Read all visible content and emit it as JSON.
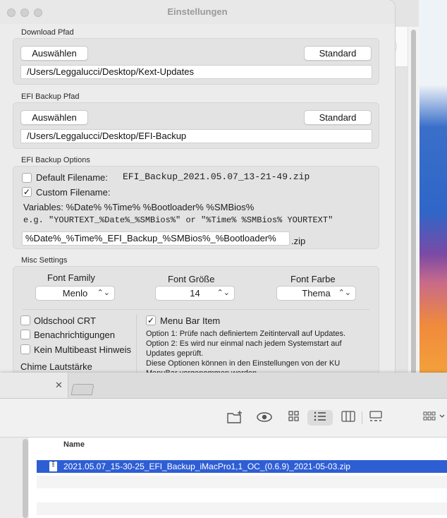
{
  "settings_window": {
    "title": "Einstellungen",
    "download_path": {
      "label": "Download Pfad",
      "choose_label": "Auswählen",
      "standard_label": "Standard",
      "value": "/Users/Leggalucci/Desktop/Kext-Updates"
    },
    "efi_backup_path": {
      "label": "EFI Backup Pfad",
      "choose_label": "Auswählen",
      "standard_label": "Standard",
      "value": "/Users/Leggalucci/Desktop/EFI-Backup"
    },
    "efi_backup_options": {
      "label": "EFI Backup Options",
      "default_filename_label": "Default Filename:",
      "default_filename_checked": false,
      "default_filename_value": "EFI_Backup_2021.05.07_13-21-49.zip",
      "custom_filename_label": "Custom Filename:",
      "custom_filename_checked": true,
      "variables_line": "Variables: %Date%  %Time%  %Bootloader%  %SMBios%",
      "example_line": "e.g. \"YOURTEXT_%Date%_%SMBios%\" or \"%Time% %SMBios% YOURTEXT\"",
      "pattern_value": "%Date%_%Time%_EFI_Backup_%SMBios%_%Bootloader%",
      "pattern_suffix": ".zip"
    },
    "misc_settings": {
      "label": "Misc Settings",
      "font_family_label": "Font Family",
      "font_family_value": "Menlo",
      "font_size_label": "Font Größe",
      "font_size_value": "14",
      "font_color_label": "Font Farbe",
      "font_color_value": "Thema",
      "oldschool_crt_label": "Oldschool CRT",
      "oldschool_crt_checked": false,
      "notifications_label": "Benachrichtigungen",
      "notifications_checked": false,
      "no_multibeast_label": "Kein Multibeast Hinweis",
      "no_multibeast_checked": false,
      "chime_volume_label": "Chime Lautstärke",
      "menu_bar_item_label": "Menu Bar Item",
      "menu_bar_item_checked": true,
      "option1_text": "Option 1: Prüfe nach definiertem Zeitintervall auf Updates.",
      "option2_text": "Option 2: Es wird nur einmal nach jedem Systemstart auf Updates geprüft.",
      "options_note": "Diese Optionen können in den Einstellungen von der KU MenuBar vorgenommen werden."
    }
  },
  "finder_window": {
    "tab_close_glyph": "✕",
    "toolbar_icons": [
      "new-folder-icon",
      "eye-icon",
      "icon-view-icon",
      "list-view-icon",
      "column-view-icon",
      "gallery-view-icon",
      "group-by-icon"
    ],
    "active_view": "list-view-icon",
    "column_name_label": "Name",
    "files": [
      {
        "name": "2021.05.07_15-30-25_EFI_Backup_iMacPro1,1_OC_(0.6.9)_2021-05-03.zip",
        "selected": true
      }
    ]
  },
  "colors": {
    "selection_blue": "#2e5ed4",
    "window_bg": "#ececec",
    "group_bg": "#e3e3e3"
  }
}
